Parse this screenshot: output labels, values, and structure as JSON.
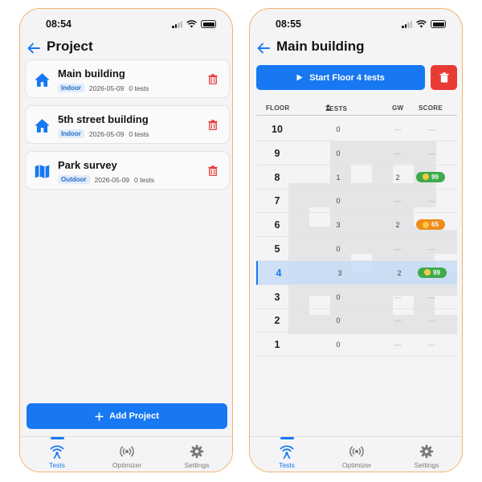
{
  "colors": {
    "accent": "#1778f2",
    "danger": "#e83b36",
    "score_good": "#3dab4a",
    "score_mid": "#f08c1a"
  },
  "left": {
    "status": {
      "time": "08:54"
    },
    "title": "Project",
    "projects": [
      {
        "name": "Main building",
        "type": "Indoor",
        "date": "2026-05-09",
        "tests": "0 tests",
        "icon": "home-icon"
      },
      {
        "name": "5th street building",
        "type": "Indoor",
        "date": "2026-05-09",
        "tests": "0 tests",
        "icon": "home-icon"
      },
      {
        "name": "Park survey",
        "type": "Outdoor",
        "date": "2026-05-09",
        "tests": "0 tests",
        "icon": "map-icon"
      }
    ],
    "add_button": "Add Project"
  },
  "right": {
    "status": {
      "time": "08:55"
    },
    "title": "Main building",
    "start_button": "Start Floor 4 tests",
    "headers": {
      "floor": "FLOOR",
      "tests": "TESTS",
      "gw": "GW",
      "score": "SCORE"
    },
    "floors": [
      {
        "floor": "10",
        "tests": "0",
        "gw": "—",
        "score": "—"
      },
      {
        "floor": "9",
        "tests": "0",
        "gw": "—",
        "score": "—"
      },
      {
        "floor": "8",
        "tests": "1",
        "gw": "2",
        "score": "99",
        "level": "good"
      },
      {
        "floor": "7",
        "tests": "0",
        "gw": "—",
        "score": "—"
      },
      {
        "floor": "6",
        "tests": "3",
        "gw": "2",
        "score": "65",
        "level": "mid"
      },
      {
        "floor": "5",
        "tests": "0",
        "gw": "—",
        "score": "—"
      },
      {
        "floor": "4",
        "tests": "3",
        "gw": "2",
        "score": "99",
        "level": "good",
        "selected": true
      },
      {
        "floor": "3",
        "tests": "0",
        "gw": "—",
        "score": "—"
      },
      {
        "floor": "2",
        "tests": "0",
        "gw": "—",
        "score": "—"
      },
      {
        "floor": "1",
        "tests": "0",
        "gw": "—",
        "score": "—"
      }
    ]
  },
  "tabs": [
    {
      "label": "Tests",
      "icon": "signal-antenna-icon",
      "active": true
    },
    {
      "label": "Optimizer",
      "icon": "broadcast-icon",
      "active": false
    },
    {
      "label": "Settings",
      "icon": "gear-icon",
      "active": false
    }
  ]
}
